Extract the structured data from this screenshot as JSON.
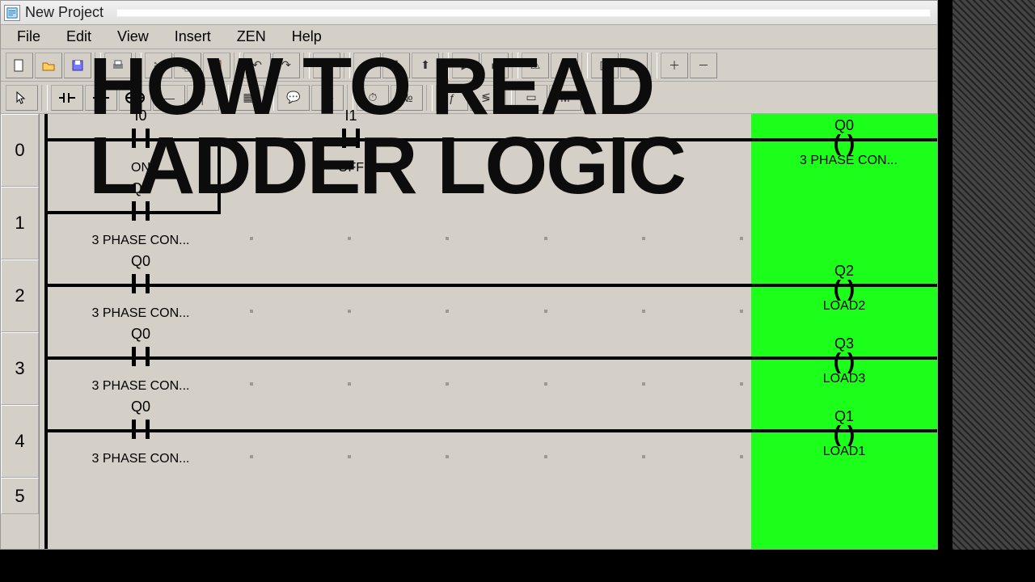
{
  "window": {
    "title": "New Project"
  },
  "menu": {
    "items": [
      "File",
      "Edit",
      "View",
      "Insert",
      "ZEN",
      "Help"
    ]
  },
  "overlay": {
    "line1": "HOW TO READ",
    "line2": "LADDER LOGIC"
  },
  "rungs": {
    "numbers": [
      "0",
      "1",
      "2",
      "3",
      "4",
      "5"
    ]
  },
  "ladder": {
    "r0": {
      "contact1": {
        "top": "I0",
        "bottom": "ON"
      },
      "contact2": {
        "top": "I1",
        "bottom": "OFF"
      },
      "coil": {
        "name": "Q0",
        "desc": "3 PHASE CON..."
      }
    },
    "r1": {
      "contact1": {
        "top": "Q0",
        "bottom": "3 PHASE CON..."
      }
    },
    "r2": {
      "contact1": {
        "top": "Q0",
        "bottom": "3 PHASE CON..."
      },
      "coil": {
        "name": "Q2",
        "desc": "LOAD2"
      }
    },
    "r3": {
      "contact1": {
        "top": "Q0",
        "bottom": "3 PHASE CON..."
      },
      "coil": {
        "name": "Q3",
        "desc": "LOAD3"
      }
    },
    "r4": {
      "contact1": {
        "top": "Q0",
        "bottom": "3 PHASE CON..."
      },
      "coil": {
        "name": "Q1",
        "desc": "LOAD1"
      }
    }
  }
}
